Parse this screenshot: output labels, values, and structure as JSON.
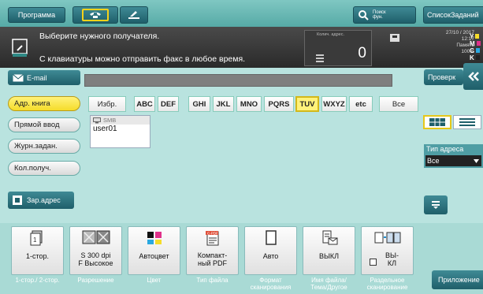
{
  "topbar": {
    "program_label": "Программа",
    "search_label": "Поиск фун.",
    "joblist_label": "СписокЗаданий"
  },
  "message": {
    "line1": "Выберите нужного получателя.",
    "line2": "С клавиатуры можно отправить факс в любое время."
  },
  "counter": {
    "label": "Колич. адрес.",
    "value": "0"
  },
  "status": {
    "date": "27/10 / 2017",
    "time": "12:17",
    "memory_label": "Память",
    "memory_value": "100%",
    "toner_y": "Y",
    "toner_m": "M",
    "toner_c": "C",
    "toner_k": "K"
  },
  "email_button": "E-mail",
  "check_button": "Проверк",
  "left_nav": [
    "Адр. книга",
    "Прямой ввод",
    "Журн.задан.",
    "Кол.получ."
  ],
  "register_button": "Зар.адрес",
  "index_tabs": [
    "Избр.",
    "ABC",
    "DEF",
    "GHI",
    "JKL",
    "MNO",
    "PQRS",
    "TUV",
    "WXYZ",
    "etc",
    "Все"
  ],
  "selected_index": "TUV",
  "address": {
    "type_label": "SMB",
    "name": "user01"
  },
  "address_type": {
    "label": "Тип адреса",
    "value": "Все"
  },
  "tiles": [
    {
      "label": "1-стор.",
      "bottom": "1-стор./ 2-стор."
    },
    {
      "label": "S 300 dpi\nF Высокое",
      "bottom": "Разрешение"
    },
    {
      "label": "Автоцвет",
      "bottom": "Цвет"
    },
    {
      "label": "Компакт-\nный PDF",
      "bottom": "Тип файла"
    },
    {
      "label": "Авто",
      "bottom": "Формат сканирования"
    },
    {
      "label": "ВЫКЛ",
      "bottom": "Имя файла/ Тема/Другое"
    },
    {
      "label": "ВЫ-\nКЛ",
      "bottom": "Раздельное сканирование"
    }
  ],
  "app_button": "Приложение",
  "colors": {
    "accent_yellow": "#f5dc2a",
    "background": "#b9e3df",
    "dark_bar": "#2a2a2a"
  }
}
